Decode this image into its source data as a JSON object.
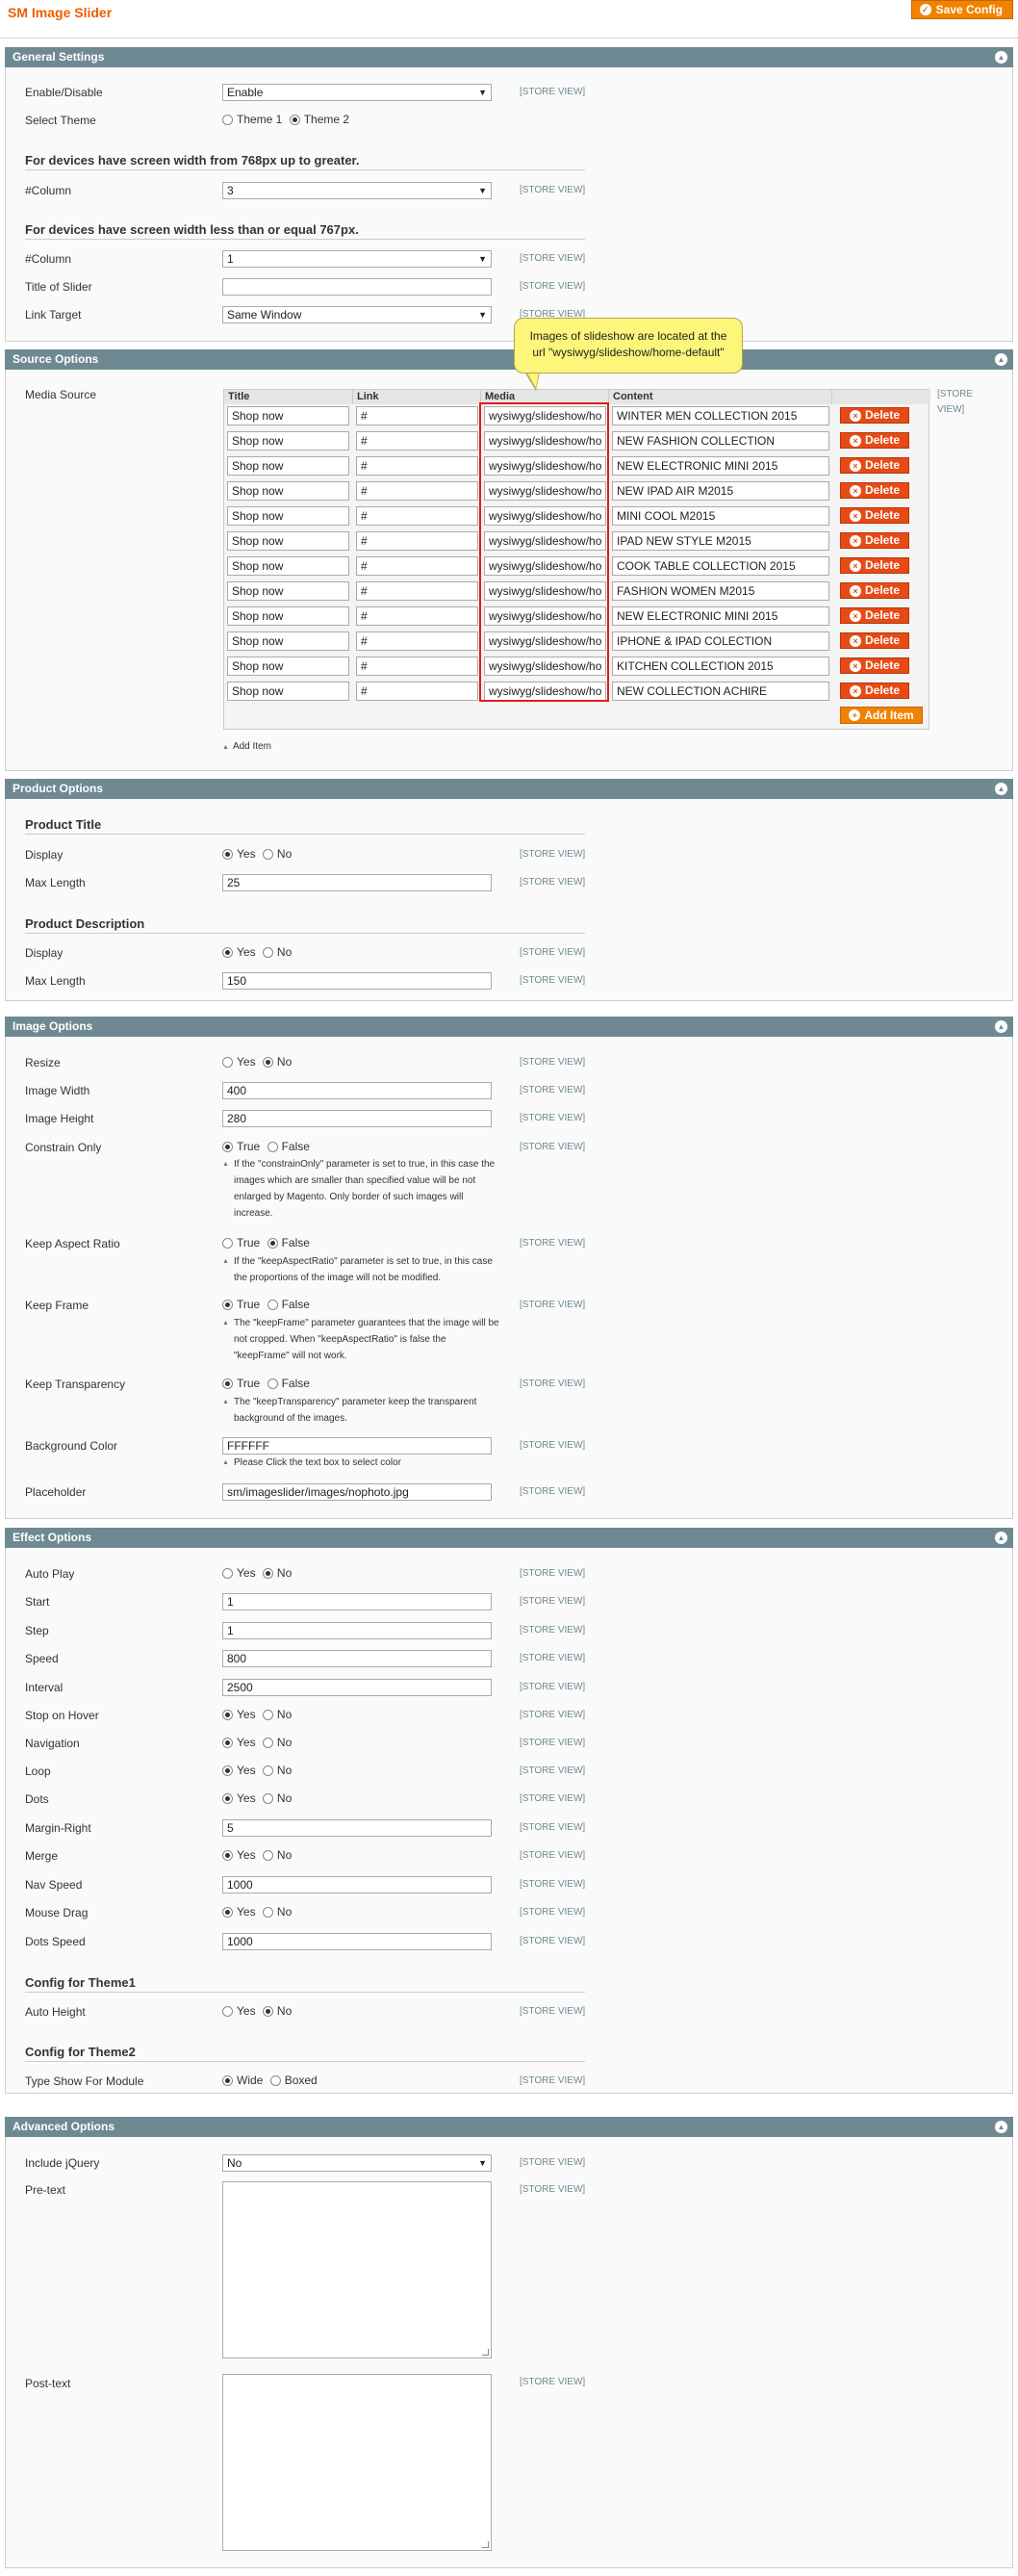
{
  "header": {
    "title": "SM Image Slider",
    "save_label": "Save Config"
  },
  "scope_text": "[STORE VIEW]",
  "general": {
    "title": "General Settings",
    "enable_label": "Enable/Disable",
    "enable_value": "Enable",
    "theme_label": "Select Theme",
    "theme_opt1": "Theme 1",
    "theme_opt2": "Theme 2",
    "sub1": "For devices have screen width from 768px up to greater.",
    "col1_label": "#Column",
    "col1_value": "3",
    "sub2": "For devices have screen width less than or equal 767px.",
    "col2_label": "#Column",
    "col2_value": "1",
    "title_label": "Title of Slider",
    "title_value": "",
    "target_label": "Link Target",
    "target_value": "Same Window"
  },
  "source": {
    "title": "Source Options",
    "media_label": "Media Source",
    "columns": [
      "Title",
      "Link",
      "Media",
      "Content"
    ],
    "rows": [
      {
        "title": "Shop now",
        "link": "#",
        "media": "wysiwyg/slideshow/ho",
        "content": "WINTER MEN COLLECTION 2015"
      },
      {
        "title": "Shop now",
        "link": "#",
        "media": "wysiwyg/slideshow/ho",
        "content": "NEW FASHION COLLECTION"
      },
      {
        "title": "Shop now",
        "link": "#",
        "media": "wysiwyg/slideshow/ho",
        "content": "NEW ELECTRONIC MINI 2015"
      },
      {
        "title": "Shop now",
        "link": "#",
        "media": "wysiwyg/slideshow/ho",
        "content": "NEW IPAD AIR  M2015"
      },
      {
        "title": "Shop now",
        "link": "#",
        "media": "wysiwyg/slideshow/ho",
        "content": "MINI COOL M2015"
      },
      {
        "title": "Shop now",
        "link": "#",
        "media": "wysiwyg/slideshow/ho",
        "content": "IPAD NEW STYLE M2015"
      },
      {
        "title": "Shop now",
        "link": "#",
        "media": "wysiwyg/slideshow/ho",
        "content": "COOK TABLE COLLECTION 2015"
      },
      {
        "title": "Shop now",
        "link": "#",
        "media": "wysiwyg/slideshow/ho",
        "content": "FASHION WOMEN M2015"
      },
      {
        "title": "Shop now",
        "link": "#",
        "media": "wysiwyg/slideshow/ho",
        "content": "NEW ELECTRONIC MINI 2015"
      },
      {
        "title": "Shop now",
        "link": "#",
        "media": "wysiwyg/slideshow/ho",
        "content": "IPHONE & IPAD COLECTION"
      },
      {
        "title": "Shop now",
        "link": "#",
        "media": "wysiwyg/slideshow/ho",
        "content": "KITCHEN COLLECTION 2015"
      },
      {
        "title": "Shop now",
        "link": "#",
        "media": "wysiwyg/slideshow/ho",
        "content": "NEW COLLECTION ACHIRE"
      }
    ],
    "delete_label": "Delete",
    "add_label": "Add Item",
    "add_item_link": "Add Item",
    "scope_line1": "[STORE",
    "scope_line2": "VIEW]",
    "callout_line1": "Images of slideshow are located  at the",
    "callout_line2": "url \"wysiwyg/slideshow/home-default\""
  },
  "product": {
    "title": "Product Options",
    "sub1": "Product Title",
    "display_label": "Display",
    "max_label": "Max Length",
    "title_max": "25",
    "sub2": "Product Description",
    "desc_max": "150",
    "yes": "Yes",
    "no": "No"
  },
  "image": {
    "title": "Image Options",
    "resize": "Resize",
    "width": "Image Width",
    "width_value": "400",
    "height": "Image Height",
    "height_value": "280",
    "constrain": "Constrain Only",
    "constrain_note": "If the \"constrainOnly\" parameter is set to true, in this case the images which are smaller than specified value will be not enlarged by Magento. Only border of such images will increase.",
    "aspect": "Keep Aspect Ratio",
    "aspect_note": "If the \"keepAspectRatio\" parameter is set to true, in this case the proportions of the image will not be modified.",
    "frame": "Keep Frame",
    "frame_note": "The \"keepFrame\" parameter guarantees that the image will be not cropped. When \"keepAspectRatio\" is false the \"keepFrame\" will not work.",
    "transparency": "Keep Transparency",
    "transparency_note": "The \"keepTransparency\" parameter keep the transparent background of the images.",
    "bg": "Background Color",
    "bg_value": "FFFFFF",
    "bg_note": "Please Click the text box to select color",
    "placeholder": "Placeholder",
    "placeholder_value": "sm/imageslider/images/nophoto.jpg",
    "yes": "Yes",
    "no": "No",
    "true": "True",
    "false": "False"
  },
  "effect": {
    "title": "Effect Options",
    "autoplay": "Auto Play",
    "start": "Start",
    "start_value": "1",
    "step": "Step",
    "step_value": "1",
    "speed": "Speed",
    "speed_value": "800",
    "interval": "Interval",
    "interval_value": "2500",
    "stop": "Stop on Hover",
    "nav": "Navigation",
    "loop": "Loop",
    "dots": "Dots",
    "margin": "Margin-Right",
    "margin_value": "5",
    "merge": "Merge",
    "navspeed": "Nav Speed",
    "navspeed_value": "1000",
    "drag": "Mouse Drag",
    "dotsspeed": "Dots Speed",
    "dotsspeed_value": "1000",
    "sub1": "Config for Theme1",
    "autoheight": "Auto Height",
    "sub2": "Config for Theme2",
    "typeshow": "Type Show For Module",
    "wide": "Wide",
    "boxed": "Boxed",
    "yes": "Yes",
    "no": "No"
  },
  "advanced": {
    "title": "Advanced Options",
    "jquery": "Include jQuery",
    "jquery_value": "No",
    "pretext": "Pre-text",
    "posttext": "Post-text"
  }
}
